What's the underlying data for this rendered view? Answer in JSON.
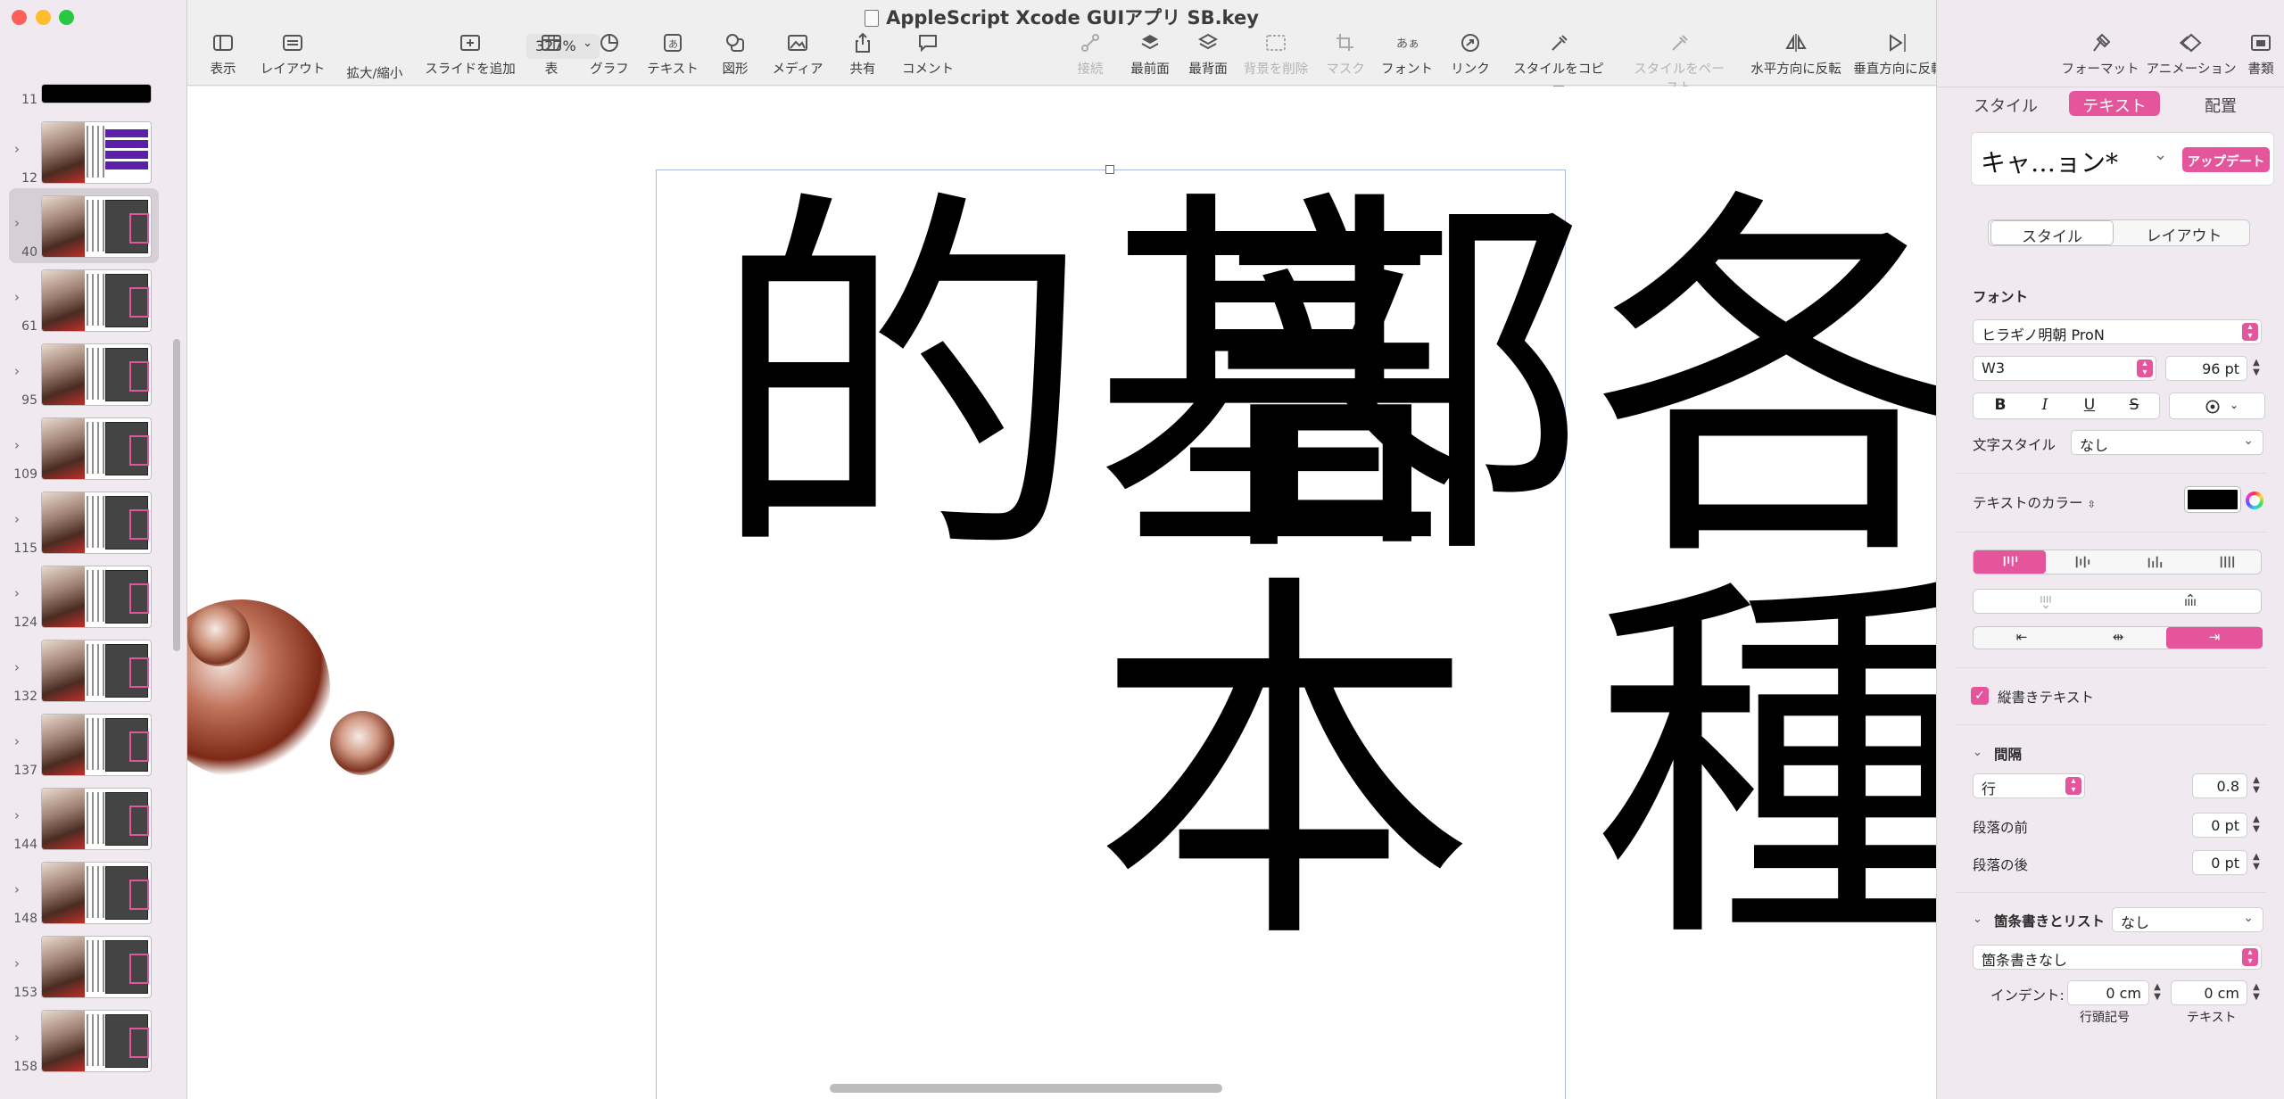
{
  "window": {
    "title": "AppleScript Xcode GUIアプリ SB.key",
    "traffic_lights": [
      "#fe5f57",
      "#febc2e",
      "#28c840"
    ]
  },
  "toolbar": {
    "view": "表示",
    "layout": "レイアウト",
    "zoom_value": "327%",
    "zoom_label": "拡大/縮小",
    "add_slide": "スライドを追加",
    "table": "表",
    "chart": "グラフ",
    "text": "テキスト",
    "shape": "図形",
    "media": "メディア",
    "share": "共有",
    "comment": "コメント",
    "connect": "接続",
    "front": "最前面",
    "back": "最背面",
    "remove_bg": "背景を削除",
    "mask": "マスク",
    "font": "フォント",
    "link": "リンク",
    "copy_style": "スタイルをコピー",
    "paste_style": "スタイルをペースト",
    "flip_h": "水平方向に反転",
    "flip_v": "垂直方向に反転",
    "format": "フォーマット",
    "animation": "アニメーション",
    "document": "書類"
  },
  "sidebar": {
    "slides": [
      {
        "num": "11",
        "variant": "black"
      },
      {
        "num": "12",
        "variant": "purple"
      },
      {
        "num": "40",
        "variant": "normal",
        "selected": true
      },
      {
        "num": "61",
        "variant": "normal"
      },
      {
        "num": "95",
        "variant": "normal"
      },
      {
        "num": "109",
        "variant": "normal"
      },
      {
        "num": "115",
        "variant": "normal"
      },
      {
        "num": "124",
        "variant": "normal"
      },
      {
        "num": "132",
        "variant": "normal"
      },
      {
        "num": "137",
        "variant": "normal"
      },
      {
        "num": "144",
        "variant": "normal"
      },
      {
        "num": "148",
        "variant": "normal"
      },
      {
        "num": "153",
        "variant": "normal"
      },
      {
        "num": "158",
        "variant": "normal"
      }
    ]
  },
  "canvas": {
    "col_right": "各種部",
    "col_left": "基本的"
  },
  "inspector": {
    "tabs": [
      "スタイル",
      "テキスト",
      "配置"
    ],
    "active_tab": "テキスト",
    "paragraph_style": "キャ…ョン*",
    "update_button": "アップデート",
    "sub_tabs": [
      "スタイル",
      "レイアウト"
    ],
    "font_label": "フォント",
    "font_family": "ヒラギノ明朝 ProN",
    "font_weight": "W3",
    "font_size": "96 pt",
    "bold": "B",
    "italic": "I",
    "underline": "U",
    "strike": "S",
    "char_style_label": "文字スタイル",
    "char_style_value": "なし",
    "text_color_label": "テキストのカラー",
    "text_color": "#000000",
    "vertical_text_label": "縦書きテキスト",
    "spacing_label": "間隔",
    "line_label": "行",
    "line_value": "0.8",
    "before_label": "段落の前",
    "before_value": "0 pt",
    "after_label": "段落の後",
    "after_value": "0 pt",
    "bullets_label": "箇条書きとリスト",
    "bullets_value": "なし",
    "bullets_style": "箇条書きなし",
    "indent_label": "インデント:",
    "indent_bullet_value": "0 cm",
    "indent_text_value": "0 cm",
    "indent_bullet_label": "行頭記号",
    "indent_text_label": "テキスト"
  },
  "accent": "#e4559b"
}
